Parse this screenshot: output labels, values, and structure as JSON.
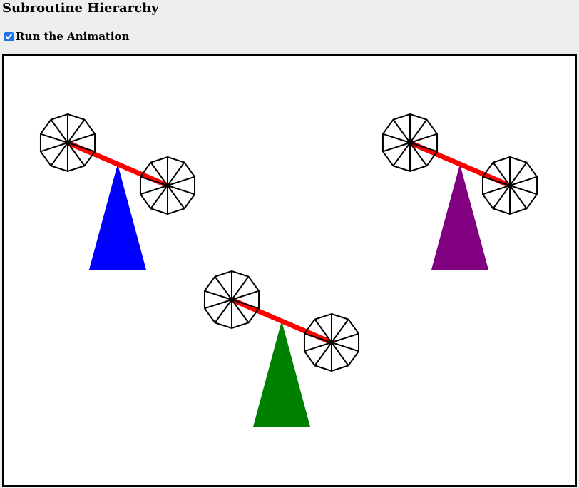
{
  "page": {
    "title": "Subroutine Hierarchy"
  },
  "controls": {
    "run_animation_label": "Run the Animation",
    "run_animation_checked": true
  },
  "scene": {
    "beam_color": "#ff0000",
    "wheel_stroke": "#000000",
    "wheel_spokes": 10,
    "seesaws": [
      {
        "id": "seesaw-top-left",
        "base_color": "#0000ff"
      },
      {
        "id": "seesaw-top-right",
        "base_color": "#800080"
      },
      {
        "id": "seesaw-bottom-center",
        "base_color": "#008000"
      }
    ]
  }
}
